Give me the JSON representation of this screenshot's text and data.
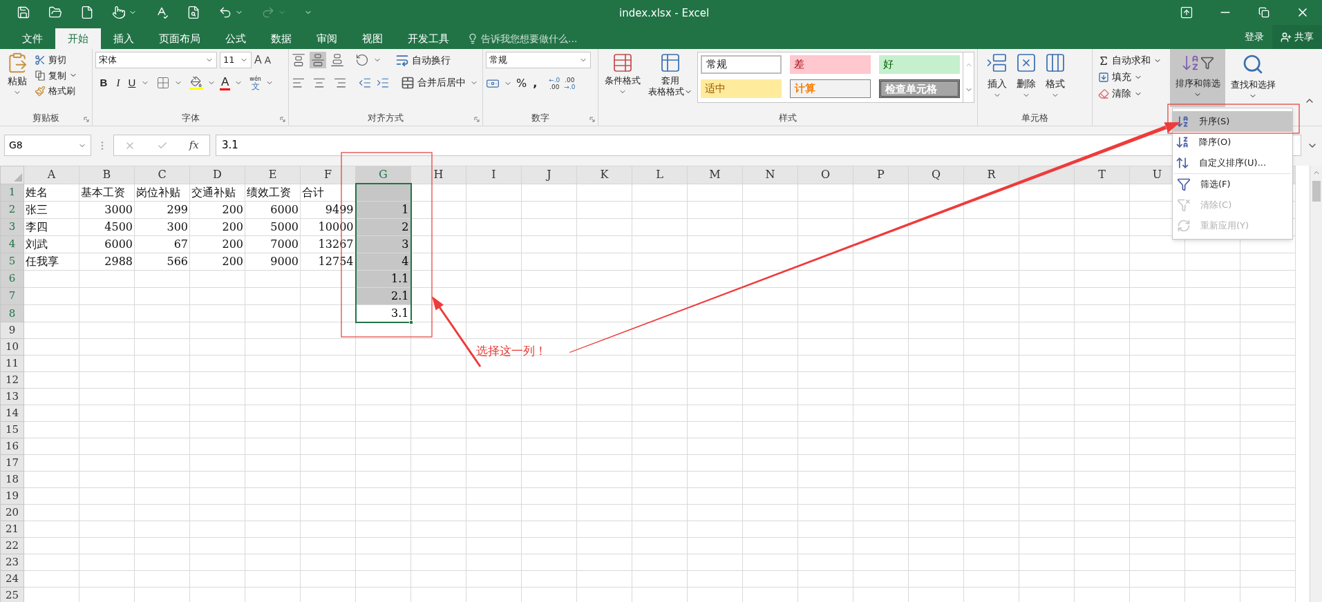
{
  "window": {
    "title": "index.xlsx - Excel"
  },
  "tabs": [
    {
      "label": "文件",
      "selected": false
    },
    {
      "label": "开始",
      "selected": true
    },
    {
      "label": "插入",
      "selected": false
    },
    {
      "label": "页面布局",
      "selected": false
    },
    {
      "label": "公式",
      "selected": false
    },
    {
      "label": "数据",
      "selected": false
    },
    {
      "label": "审阅",
      "selected": false
    },
    {
      "label": "视图",
      "selected": false
    },
    {
      "label": "开发工具",
      "selected": false
    }
  ],
  "tell_me": {
    "placeholder": "告诉我您想要做什么..."
  },
  "account": {
    "sign_in": "登录",
    "share": "共享"
  },
  "clipboard": {
    "label": "剪贴板",
    "paste": "粘贴",
    "cut": "剪切",
    "copy": "复制",
    "format_painter": "格式刷"
  },
  "font": {
    "label": "字体",
    "font_name": "宋体",
    "font_size": "11",
    "grow": "A",
    "shrink": "A",
    "bold": "B",
    "italic": "I",
    "underline": "U",
    "font_color": "A",
    "phonetic": "wén",
    "phonetic_char": "文"
  },
  "alignment": {
    "label": "对齐方式",
    "wrap_text": "自动换行",
    "merge_center": "合并后居中"
  },
  "number": {
    "label": "数字",
    "format": "常规",
    "percent": "%",
    "comma": ",",
    "increase_decimal": [
      "←.0",
      ".00"
    ],
    "decrease_decimal": [
      ".00",
      "→.0"
    ]
  },
  "styles": {
    "label": "样式",
    "conditional": "条件格式",
    "table_format": [
      "套用",
      "表格格式"
    ],
    "cell_styles": [
      {
        "label": "常规",
        "kind": "normal"
      },
      {
        "label": "差",
        "kind": "bad"
      },
      {
        "label": "好",
        "kind": "good"
      },
      {
        "label": "适中",
        "kind": "neutral"
      },
      {
        "label": "计算",
        "kind": "calculation"
      },
      {
        "label": "检查单元格",
        "kind": "check"
      }
    ]
  },
  "cells": {
    "label": "单元格",
    "buttons": [
      {
        "label": "插入",
        "kind": "insert"
      },
      {
        "label": "删除",
        "kind": "delete"
      },
      {
        "label": "格式",
        "kind": "format"
      }
    ]
  },
  "editing": {
    "autosum": "自动求和",
    "fill": "填充",
    "clear": "清除",
    "sort_filter": {
      "label": "排序和筛选",
      "expanded": true
    },
    "find_select": "查找和选择"
  },
  "formula_bar": {
    "name_box": "G8",
    "function": "fx",
    "value": "3.1"
  },
  "sheet": {
    "columns": [
      {
        "label": "A",
        "selected": false
      },
      {
        "label": "B",
        "selected": false
      },
      {
        "label": "C",
        "selected": false
      },
      {
        "label": "D",
        "selected": false
      },
      {
        "label": "E",
        "selected": false
      },
      {
        "label": "F",
        "selected": false
      },
      {
        "label": "G",
        "selected": true
      },
      {
        "label": "H",
        "selected": false
      },
      {
        "label": "I",
        "selected": false
      },
      {
        "label": "J",
        "selected": false
      },
      {
        "label": "K",
        "selected": false
      },
      {
        "label": "L",
        "selected": false
      },
      {
        "label": "M",
        "selected": false
      },
      {
        "label": "N",
        "selected": false
      },
      {
        "label": "O",
        "selected": false
      },
      {
        "label": "P",
        "selected": false
      },
      {
        "label": "Q",
        "selected": false
      },
      {
        "label": "R",
        "selected": false
      },
      {
        "selected": false
      },
      {
        "label": "T",
        "selected": false
      },
      {
        "label": "U",
        "selected": false
      }
    ],
    "rows": [
      {
        "number": "1",
        "selected": true,
        "kind": "header",
        "cells": [
          "姓名",
          "基本工资",
          "岗位补贴",
          "交通补贴",
          "绩效工资",
          "合计"
        ],
        "g": {
          "selected": true,
          "active": false
        }
      },
      {
        "number": "2",
        "selected": true,
        "kind": "data",
        "cells": [
          "张三",
          "3000",
          "299",
          "200",
          "6000",
          "9499"
        ],
        "g": {
          "value": "1",
          "selected": true,
          "active": false
        }
      },
      {
        "number": "3",
        "selected": true,
        "kind": "data",
        "cells": [
          "李四",
          "4500",
          "300",
          "200",
          "5000",
          "10000"
        ],
        "g": {
          "value": "2",
          "selected": true,
          "active": false
        }
      },
      {
        "number": "4",
        "selected": true,
        "kind": "data",
        "cells": [
          "刘武",
          "6000",
          "67",
          "200",
          "7000",
          "13267"
        ],
        "g": {
          "value": "3",
          "selected": true,
          "active": false
        }
      },
      {
        "number": "5",
        "selected": true,
        "kind": "data",
        "cells": [
          "任我享",
          "2988",
          "566",
          "200",
          "9000",
          "12754"
        ],
        "g": {
          "value": "4",
          "selected": true,
          "active": false
        }
      },
      {
        "number": "6",
        "selected": true,
        "g": {
          "value": "1.1",
          "selected": true,
          "active": false
        }
      },
      {
        "number": "7",
        "selected": true,
        "g": {
          "value": "2.1",
          "selected": true,
          "active": false
        }
      },
      {
        "number": "8",
        "selected": true,
        "g": {
          "value": "3.1",
          "selected": true,
          "active": true
        }
      },
      {
        "number": "9",
        "selected": false
      },
      {
        "number": "10",
        "selected": false
      },
      {
        "number": "11",
        "selected": false
      },
      {
        "number": "12",
        "selected": false
      },
      {
        "number": "13",
        "selected": false
      },
      {
        "number": "14",
        "selected": false
      },
      {
        "number": "15",
        "selected": false
      },
      {
        "number": "16",
        "selected": false
      },
      {
        "number": "17",
        "selected": false
      },
      {
        "number": "18",
        "selected": false
      },
      {
        "number": "19",
        "selected": false
      },
      {
        "number": "20",
        "selected": false
      },
      {
        "number": "21",
        "selected": false
      },
      {
        "number": "22",
        "selected": false
      },
      {
        "number": "23",
        "selected": false
      },
      {
        "number": "24",
        "selected": false
      },
      {
        "number": "25",
        "selected": false
      }
    ]
  },
  "sort_menu": {
    "groups": [
      [
        {
          "label": "升序(S)",
          "kind": "ascending",
          "selected": true,
          "disabled": false
        },
        {
          "label": "降序(O)",
          "kind": "descending",
          "selected": false,
          "disabled": false
        },
        {
          "label": "自定义排序(U)...",
          "kind": "custom",
          "selected": false,
          "disabled": false
        }
      ],
      [
        {
          "label": "筛选(F)",
          "kind": "filter",
          "selected": false,
          "disabled": false
        },
        {
          "label": "清除(C)",
          "kind": "clear",
          "selected": false,
          "disabled": true
        },
        {
          "label": "重新应用(Y)",
          "kind": "reapply",
          "selected": false,
          "disabled": true
        }
      ]
    ]
  },
  "annotation": {
    "text": "选择这一列！"
  }
}
